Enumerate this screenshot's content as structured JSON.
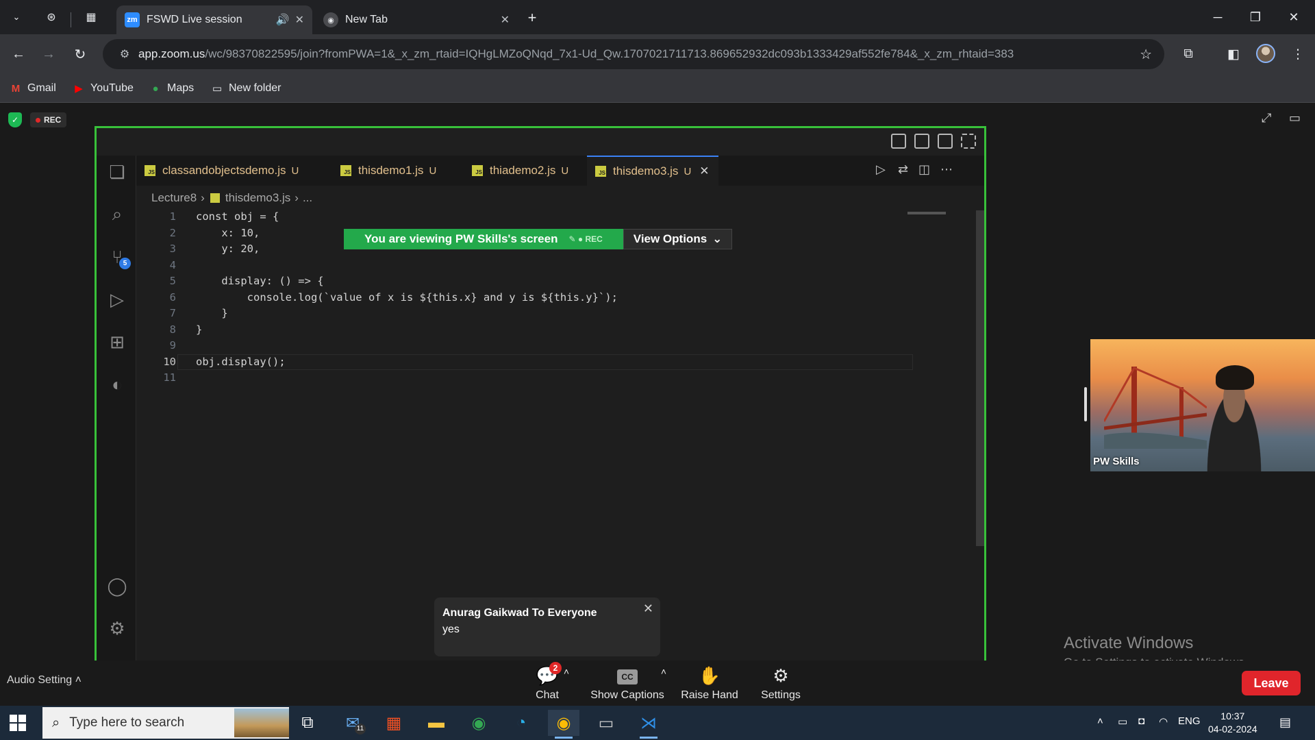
{
  "browser": {
    "tabs": [
      {
        "title": "FSWD Live session",
        "favicon": "zm",
        "active": true,
        "audio": true
      },
      {
        "title": "New Tab",
        "favicon": "chrome-icon",
        "active": false
      }
    ],
    "url_host": "app.zoom.us",
    "url_path": "/wc/98370822595/join?fromPWA=1&_x_zm_rtaid=IQHgLMZoQNqd_7x1-Ud_Qw.1707021711713.869652932dc093b1333429af552fe784&_x_zm_rhtaid=383",
    "bookmarks": [
      {
        "label": "Gmail",
        "icon": "gmail-icon"
      },
      {
        "label": "YouTube",
        "icon": "youtube-icon"
      },
      {
        "label": "Maps",
        "icon": "maps-icon"
      },
      {
        "label": "New folder",
        "icon": "folder-icon"
      }
    ]
  },
  "zoom": {
    "rec_label": "REC",
    "banner_text": "You are viewing  PW Skills's screen",
    "banner_rec": "REC",
    "view_options": "View Options",
    "participant_name": "PW Skills",
    "chat_popup": {
      "from": "Anurag Gaikwad To Everyone",
      "message": "yes"
    },
    "activate": {
      "title": "Activate Windows",
      "subtitle": "Go to Settings to activate Windows."
    },
    "audio_setting": "Audio Setting",
    "controls": [
      {
        "label": "Chat",
        "icon": "chat-icon",
        "badge": "2"
      },
      {
        "label": "Show Captions",
        "icon": "cc-icon",
        "icon_text": "CC"
      },
      {
        "label": "Raise Hand",
        "icon": "hand-icon"
      },
      {
        "label": "Settings",
        "icon": "gear-icon"
      }
    ],
    "leave": "Leave"
  },
  "vscode": {
    "tabs": [
      {
        "name": "classandobjectsdemo.js",
        "status": "U"
      },
      {
        "name": "thisdemo1.js",
        "status": "U"
      },
      {
        "name": "thiademo2.js",
        "status": "U"
      },
      {
        "name": "thisdemo3.js",
        "status": "U",
        "active": true
      }
    ],
    "breadcrumb": {
      "folder": "Lecture8",
      "file": "thisdemo3.js",
      "more": "..."
    },
    "scm_badge": "5",
    "current_line": 10,
    "lines": [
      "const obj = {",
      "    x: 10,",
      "    y: 20,",
      "",
      "    display: () => {",
      "        console.log(`value of x is ${this.x} and y is ${this.y}`);",
      "    }",
      "}",
      "",
      "obj.display();",
      ""
    ]
  },
  "taskbar": {
    "search_placeholder": "Type here to search",
    "mail_badge": "11",
    "lang": "ENG",
    "time": "10:37",
    "date": "04-02-2024"
  }
}
